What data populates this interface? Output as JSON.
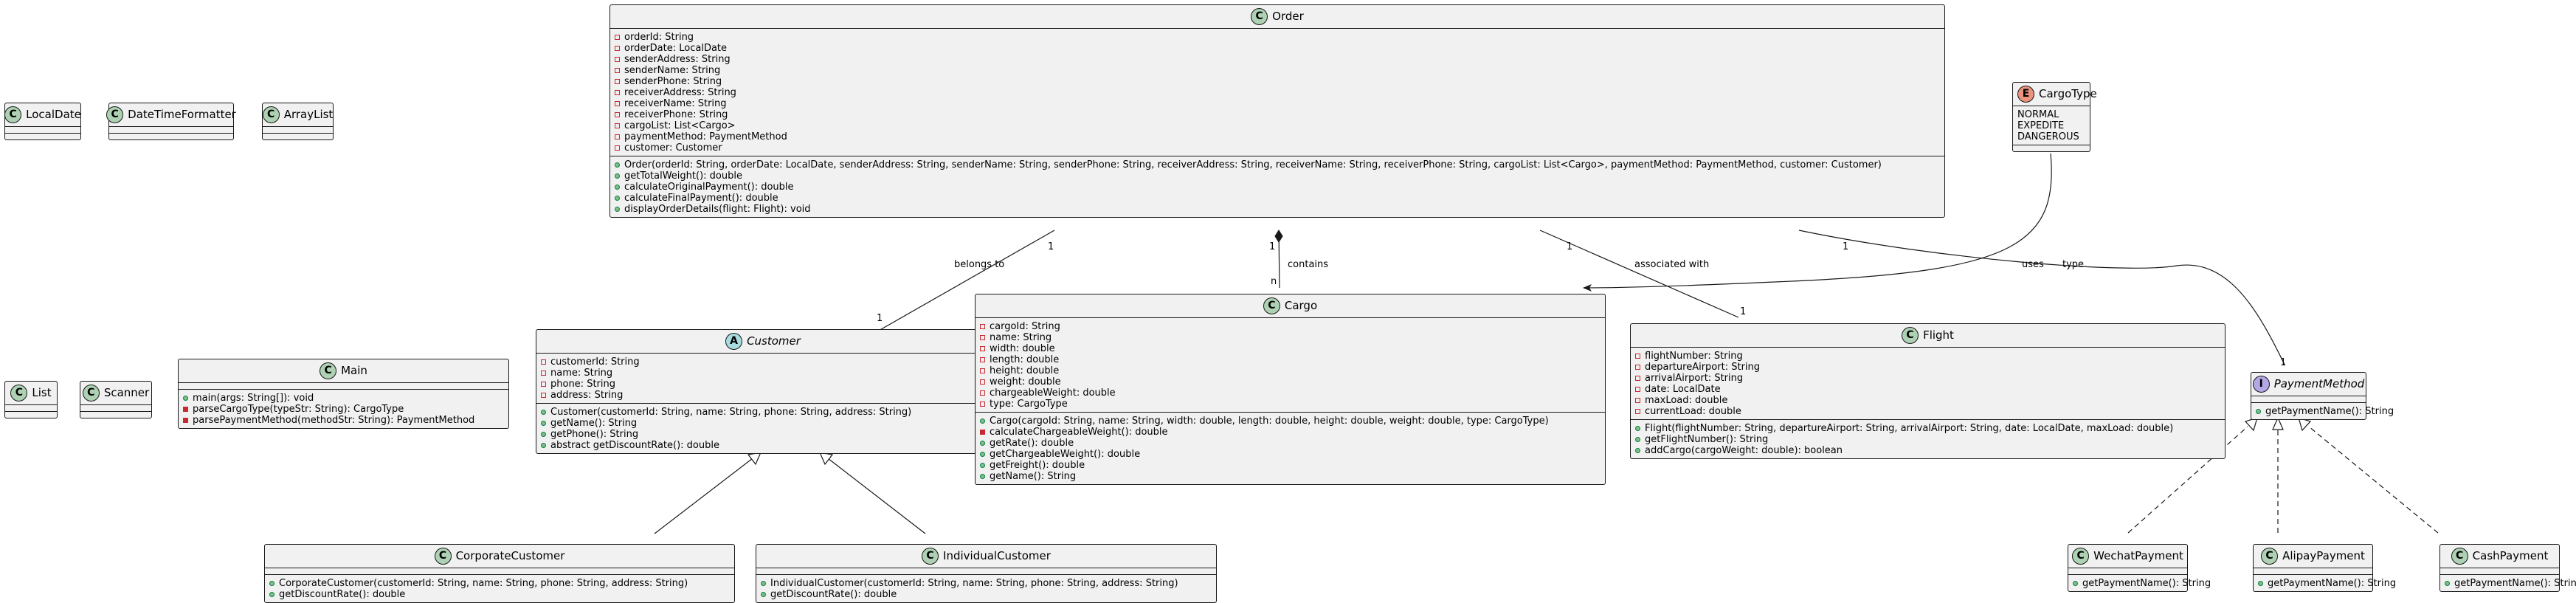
{
  "classes": [
    {
      "id": "LocalDate",
      "name": "LocalDate",
      "kind": "class",
      "fields": [],
      "methods": []
    },
    {
      "id": "DateTimeFormatter",
      "name": "DateTimeFormatter",
      "kind": "class",
      "fields": [],
      "methods": []
    },
    {
      "id": "ArrayList",
      "name": "ArrayList",
      "kind": "class",
      "fields": [],
      "methods": []
    },
    {
      "id": "List",
      "name": "List",
      "kind": "class",
      "fields": [],
      "methods": []
    },
    {
      "id": "Scanner",
      "name": "Scanner",
      "kind": "class",
      "fields": [],
      "methods": []
    },
    {
      "id": "Order",
      "name": "Order",
      "kind": "class",
      "fields": [
        {
          "v": "private",
          "t": "orderId: String"
        },
        {
          "v": "private",
          "t": "orderDate: LocalDate"
        },
        {
          "v": "private",
          "t": "senderAddress: String"
        },
        {
          "v": "private",
          "t": "senderName: String"
        },
        {
          "v": "private",
          "t": "senderPhone: String"
        },
        {
          "v": "private",
          "t": "receiverAddress: String"
        },
        {
          "v": "private",
          "t": "receiverName: String"
        },
        {
          "v": "private",
          "t": "receiverPhone: String"
        },
        {
          "v": "private",
          "t": "cargoList: List<Cargo>"
        },
        {
          "v": "private",
          "t": "paymentMethod: PaymentMethod"
        },
        {
          "v": "private",
          "t": "customer: Customer"
        }
      ],
      "methods": [
        {
          "v": "public",
          "t": "Order(orderId: String, orderDate: LocalDate, senderAddress: String, senderName: String, senderPhone: String, receiverAddress: String, receiverName: String, receiverPhone: String, cargoList: List<Cargo>, paymentMethod: PaymentMethod, customer: Customer)"
        },
        {
          "v": "public",
          "t": "getTotalWeight(): double"
        },
        {
          "v": "public",
          "t": "calculateOriginalPayment(): double"
        },
        {
          "v": "public",
          "t": "calculateFinalPayment(): double"
        },
        {
          "v": "public",
          "t": "displayOrderDetails(flight: Flight): void"
        }
      ]
    },
    {
      "id": "CargoType",
      "name": "CargoType",
      "kind": "enum",
      "fields": [
        {
          "v": "none",
          "t": "NORMAL"
        },
        {
          "v": "none",
          "t": "EXPEDITE"
        },
        {
          "v": "none",
          "t": "DANGEROUS"
        }
      ],
      "methods": []
    },
    {
      "id": "Main",
      "name": "Main",
      "kind": "class",
      "fields": [],
      "methods": [
        {
          "v": "public",
          "t": "main(args: String[]): void"
        },
        {
          "v": "privatem",
          "t": "parseCargoType(typeStr: String): CargoType"
        },
        {
          "v": "privatem",
          "t": "parsePaymentMethod(methodStr: String): PaymentMethod"
        }
      ]
    },
    {
      "id": "Customer",
      "name": "Customer",
      "kind": "abstract",
      "fields": [
        {
          "v": "private",
          "t": "customerId: String"
        },
        {
          "v": "private",
          "t": "name: String"
        },
        {
          "v": "private",
          "t": "phone: String"
        },
        {
          "v": "private",
          "t": "address: String"
        }
      ],
      "methods": [
        {
          "v": "public",
          "t": "Customer(customerId: String, name: String, phone: String, address: String)"
        },
        {
          "v": "public",
          "t": "getName(): String"
        },
        {
          "v": "public",
          "t": "getPhone(): String"
        },
        {
          "v": "public",
          "t": "abstract getDiscountRate(): double"
        }
      ]
    },
    {
      "id": "Cargo",
      "name": "Cargo",
      "kind": "class",
      "fields": [
        {
          "v": "private",
          "t": "cargoId: String"
        },
        {
          "v": "private",
          "t": "name: String"
        },
        {
          "v": "private",
          "t": "width: double"
        },
        {
          "v": "private",
          "t": "length: double"
        },
        {
          "v": "private",
          "t": "height: double"
        },
        {
          "v": "private",
          "t": "weight: double"
        },
        {
          "v": "private",
          "t": "chargeableWeight: double"
        },
        {
          "v": "private",
          "t": "type: CargoType"
        }
      ],
      "methods": [
        {
          "v": "public",
          "t": "Cargo(cargoId: String, name: String, width: double, length: double, height: double, weight: double, type: CargoType)"
        },
        {
          "v": "privatem",
          "t": "calculateChargeableWeight(): double"
        },
        {
          "v": "public",
          "t": "getRate(): double"
        },
        {
          "v": "public",
          "t": "getChargeableWeight(): double"
        },
        {
          "v": "public",
          "t": "getFreight(): double"
        },
        {
          "v": "public",
          "t": "getName(): String"
        }
      ]
    },
    {
      "id": "Flight",
      "name": "Flight",
      "kind": "class",
      "fields": [
        {
          "v": "private",
          "t": "flightNumber: String"
        },
        {
          "v": "private",
          "t": "departureAirport: String"
        },
        {
          "v": "private",
          "t": "arrivalAirport: String"
        },
        {
          "v": "private",
          "t": "date: LocalDate"
        },
        {
          "v": "private",
          "t": "maxLoad: double"
        },
        {
          "v": "private",
          "t": "currentLoad: double"
        }
      ],
      "methods": [
        {
          "v": "public",
          "t": "Flight(flightNumber: String, departureAirport: String, arrivalAirport: String, date: LocalDate, maxLoad: double)"
        },
        {
          "v": "public",
          "t": "getFlightNumber(): String"
        },
        {
          "v": "public",
          "t": "addCargo(cargoWeight: double): boolean"
        }
      ]
    },
    {
      "id": "PaymentMethod",
      "name": "PaymentMethod",
      "kind": "interface",
      "fields": [],
      "methods": [
        {
          "v": "public",
          "t": "getPaymentName(): String"
        }
      ]
    },
    {
      "id": "CorporateCustomer",
      "name": "CorporateCustomer",
      "kind": "class",
      "fields": [],
      "methods": [
        {
          "v": "public",
          "t": "CorporateCustomer(customerId: String, name: String, phone: String, address: String)"
        },
        {
          "v": "public",
          "t": "getDiscountRate(): double"
        }
      ]
    },
    {
      "id": "IndividualCustomer",
      "name": "IndividualCustomer",
      "kind": "class",
      "fields": [],
      "methods": [
        {
          "v": "public",
          "t": "IndividualCustomer(customerId: String, name: String, phone: String, address: String)"
        },
        {
          "v": "public",
          "t": "getDiscountRate(): double"
        }
      ]
    },
    {
      "id": "WechatPayment",
      "name": "WechatPayment",
      "kind": "class",
      "fields": [],
      "methods": [
        {
          "v": "public",
          "t": "getPaymentName(): String"
        }
      ]
    },
    {
      "id": "AlipayPayment",
      "name": "AlipayPayment",
      "kind": "class",
      "fields": [],
      "methods": [
        {
          "v": "public",
          "t": "getPaymentName(): String"
        }
      ]
    },
    {
      "id": "CashPayment",
      "name": "CashPayment",
      "kind": "class",
      "fields": [],
      "methods": [
        {
          "v": "public",
          "t": "getPaymentName(): String"
        }
      ]
    }
  ],
  "relations": [
    {
      "id": "order-customer",
      "from": "Order",
      "to": "Customer",
      "type": "association",
      "label": "belongs to",
      "from_mult": "1",
      "to_mult": "1"
    },
    {
      "id": "order-cargo",
      "from": "Order",
      "to": "Cargo",
      "type": "composition",
      "label": "contains",
      "from_mult": "1",
      "to_mult": "n"
    },
    {
      "id": "order-flight",
      "from": "Order",
      "to": "Flight",
      "type": "association",
      "label": "associated with",
      "from_mult": "1",
      "to_mult": "1"
    },
    {
      "id": "order-payment",
      "from": "Order",
      "to": "PaymentMethod",
      "type": "association",
      "label": "uses",
      "from_mult": "1",
      "to_mult": "1"
    },
    {
      "id": "cargotype-cargo",
      "from": "CargoType",
      "to": "Cargo",
      "type": "dependency-arrow",
      "label": "type",
      "from_mult": "",
      "to_mult": ""
    },
    {
      "id": "corporate-customer",
      "from": "CorporateCustomer",
      "to": "Customer",
      "type": "inheritance",
      "label": "",
      "from_mult": "",
      "to_mult": ""
    },
    {
      "id": "individual-customer",
      "from": "IndividualCustomer",
      "to": "Customer",
      "type": "inheritance",
      "label": "",
      "from_mult": "",
      "to_mult": ""
    },
    {
      "id": "wechat-payment",
      "from": "WechatPayment",
      "to": "PaymentMethod",
      "type": "realization",
      "label": "",
      "from_mult": "",
      "to_mult": ""
    },
    {
      "id": "alipay-payment",
      "from": "AlipayPayment",
      "to": "PaymentMethod",
      "type": "realization",
      "label": "",
      "from_mult": "",
      "to_mult": ""
    },
    {
      "id": "cash-payment",
      "from": "CashPayment",
      "to": "PaymentMethod",
      "type": "realization",
      "label": "",
      "from_mult": "",
      "to_mult": ""
    }
  ],
  "badges": {
    "class": "C",
    "abstract": "A",
    "interface": "I",
    "enum": "E"
  }
}
